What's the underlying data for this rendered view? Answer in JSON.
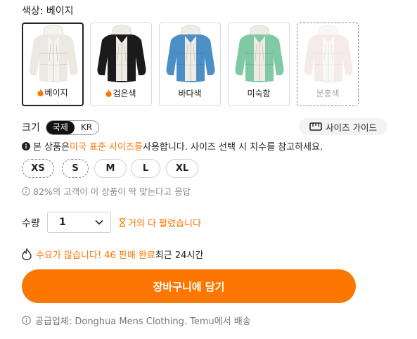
{
  "color": {
    "label": "색상: 베이지",
    "options": [
      {
        "name": "베이지",
        "hot": true,
        "selected": true,
        "available": true,
        "body": "#ece9e3",
        "hood": "#f6f3ee"
      },
      {
        "name": "검은색",
        "hot": true,
        "selected": false,
        "available": true,
        "body": "#1b1b1b",
        "hood": "#eeebe5"
      },
      {
        "name": "바다색",
        "hot": false,
        "selected": false,
        "available": true,
        "body": "#4c8fc7",
        "hood": "#eeebe5"
      },
      {
        "name": "미숙함",
        "hot": false,
        "selected": false,
        "available": true,
        "body": "#7fc9a4",
        "hood": "#eeebe5"
      },
      {
        "name": "분홍색",
        "hot": false,
        "selected": false,
        "available": false,
        "body": "#e6d3d0",
        "hood": "#f4efec"
      }
    ]
  },
  "size": {
    "label": "크기",
    "region_on": "국제",
    "region_off": "KR",
    "guide_label": "사이즈 가이드",
    "notice_pre": "본 상품은 ",
    "notice_highlight": "미국 표준 사이즈를",
    "notice_post": " 사용합니다. 사이즈 선택 시 치수를 참고하세요.",
    "options": [
      "XS",
      "S",
      "M",
      "L",
      "XL"
    ],
    "fit_note": "82%의 고객이 이 상품이 딱 맞는다고 응답"
  },
  "quantity": {
    "label": "수량",
    "value": "1",
    "selling_fast": "거의 다 팔렸습니다"
  },
  "demand": {
    "orange_text": "수요가 많습니다! 46 판매 완료",
    "dark_text": " 최근 24시간"
  },
  "cart": {
    "button_label": "장바구니에 담기"
  },
  "supplier": {
    "text": "공급업체: Donghua Mens Clothing. Temu에서 배송"
  },
  "colors": {
    "accent": "#fb7701"
  }
}
